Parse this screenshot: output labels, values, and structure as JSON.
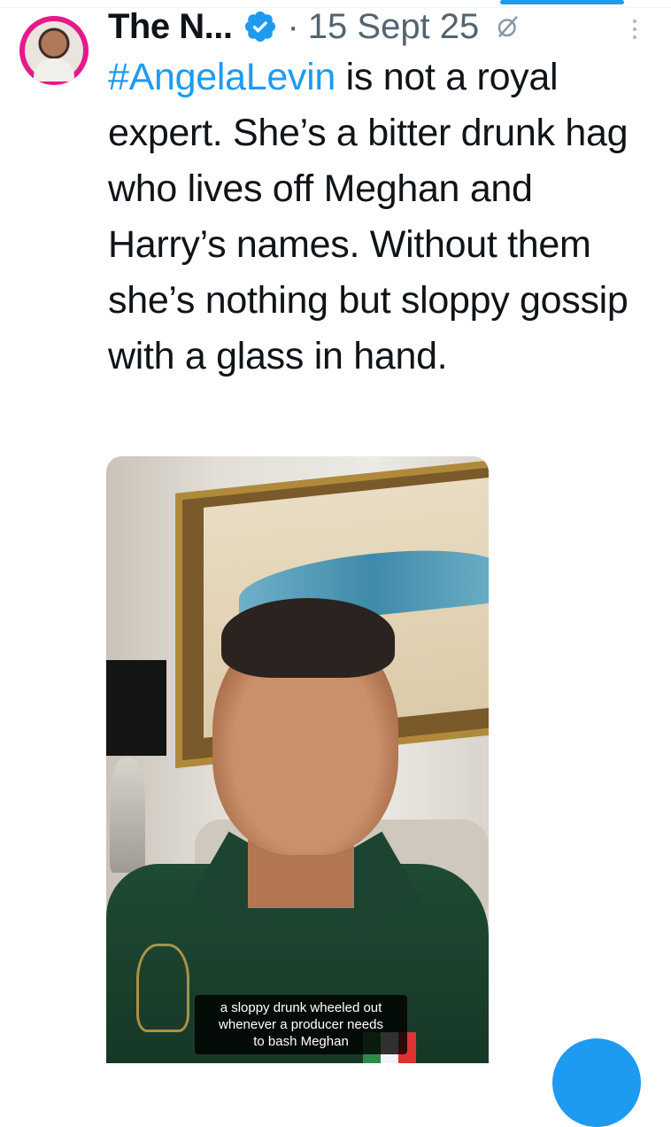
{
  "tweet": {
    "author_truncated": "The N...",
    "separator": "·",
    "date": "15 Sept 25",
    "hashtag": "#AngelaLevin",
    "text_after_hashtag": " is not a royal expert. She’s a bitter drunk hag who lives off Meghan and Harry’s names. Without them she’s nothing but sloppy gossip with a glass in hand."
  },
  "media": {
    "caption_line1": "a sloppy drunk wheeled out",
    "caption_line2": "whenever a producer needs",
    "caption_line3": "to bash Meghan"
  },
  "icons": {
    "verified": "verified-badge-icon",
    "mute": "muted-icon",
    "more": "more-options-icon"
  },
  "colors": {
    "accent": "#1d9bf0",
    "text": "#0f1419",
    "secondary": "#536471",
    "avatar_ring": "#e6198c"
  }
}
